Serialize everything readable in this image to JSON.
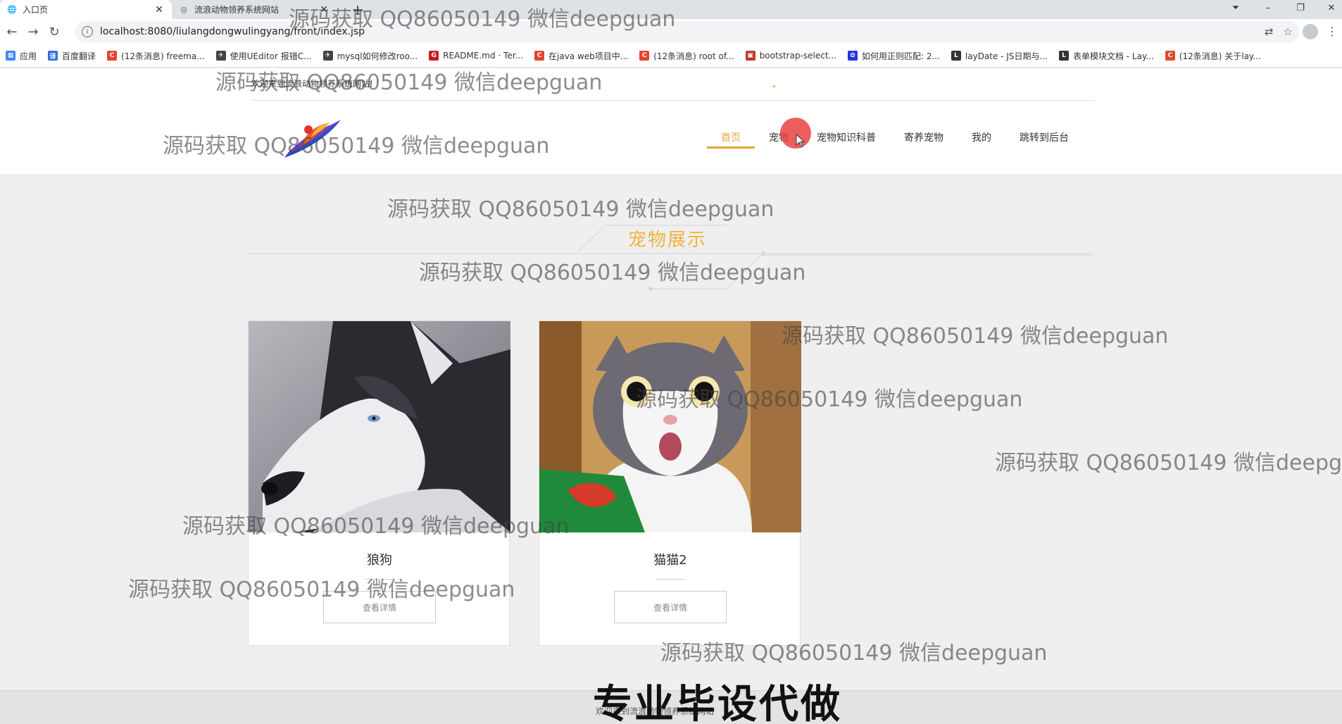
{
  "browser": {
    "tabs": [
      {
        "label": "入口页",
        "icon": "globe-icon"
      },
      {
        "label": "流浪动物领养系统网站",
        "icon": "shield-icon"
      }
    ],
    "address": "localhost:8080/liulangdongwulingyang/front/index.jsp",
    "bookmarks": [
      {
        "label": "应用",
        "icon": "apps-grid-icon",
        "color": "#4285f4"
      },
      {
        "label": "百度翻译",
        "icon": "translate-icon",
        "color": "#2f6fe6"
      },
      {
        "label": "(12条消息) freema...",
        "icon": "csdn-icon",
        "color": "#e5462f"
      },
      {
        "label": "使用UEditor 报错C...",
        "icon": "bird-icon",
        "color": "#444444"
      },
      {
        "label": "mysql如何修改roo...",
        "icon": "bird-icon",
        "color": "#444444"
      },
      {
        "label": "README.md · Ter...",
        "icon": "gitee-icon",
        "color": "#c71d23"
      },
      {
        "label": "在java web项目中...",
        "icon": "csdn-icon",
        "color": "#e5462f"
      },
      {
        "label": "(12条消息) root of...",
        "icon": "csdn-icon",
        "color": "#e5462f"
      },
      {
        "label": "bootstrap-select...",
        "icon": "cnblogs-icon",
        "color": "#c0392b"
      },
      {
        "label": "如何用正则匹配: 2...",
        "icon": "baidu-paw-icon",
        "color": "#2932e1"
      },
      {
        "label": "layDate - JS日期与...",
        "icon": "layui-icon",
        "color": "#333333"
      },
      {
        "label": "表单模块文档 - Lay...",
        "icon": "layui-icon",
        "color": "#333333"
      },
      {
        "label": "(12条消息) 关于lay...",
        "icon": "csdn-icon",
        "color": "#e5462f"
      }
    ]
  },
  "site": {
    "welcome": "欢迎来到流浪动物领养系统网站!",
    "nav": [
      "首页",
      "宠物",
      "宠物知识科普",
      "寄养宠物",
      "我的",
      "跳转到后台"
    ],
    "active_nav": 0,
    "accent_color": "#e8a33d"
  },
  "section": {
    "title": "宠物展示"
  },
  "cards": [
    {
      "name": "狼狗",
      "button": "查看详情"
    },
    {
      "name": "猫猫2",
      "button": "查看详情"
    }
  ],
  "footer": {
    "text": "欢迎来到流浪动物领养系统网站"
  },
  "watermark": {
    "text": "源码获取 QQ86050149 微信deepguan",
    "promo": "专业毕设代做"
  }
}
